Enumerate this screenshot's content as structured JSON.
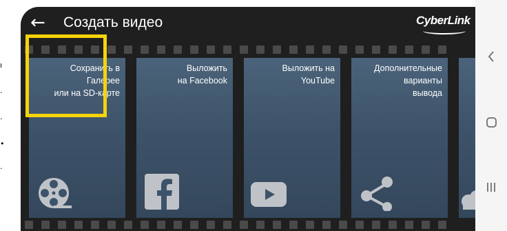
{
  "screen": {
    "title": "Создать видео",
    "back_icon": "arrow-left-icon",
    "brand_logo": "CyberLink"
  },
  "cards": [
    {
      "id": "gallery",
      "label": "Сохранить в\nГалерее\nили на SD-карте",
      "icon": "film-reel-icon"
    },
    {
      "id": "facebook",
      "label": "Выложить\nна Facebook",
      "icon": "facebook-icon"
    },
    {
      "id": "youtube",
      "label": "Выложить на\nYouTube",
      "icon": "youtube-icon"
    },
    {
      "id": "more",
      "label": "Дополнительные\nварианты\nвывода",
      "icon": "share-icon"
    },
    {
      "id": "cloud",
      "label": "",
      "icon": "cloud-icon"
    }
  ],
  "left_strip_glyphs": [
    "ı",
    "·",
    "·",
    "•",
    "·"
  ],
  "nav": {
    "back": "chevron-left-icon",
    "home": "rounded-square-icon",
    "recents": "recent-apps-icon"
  },
  "colors": {
    "highlight": "#f5d30a",
    "screen_bg": "#1f1f1f",
    "card_bg": "#4b637a"
  }
}
